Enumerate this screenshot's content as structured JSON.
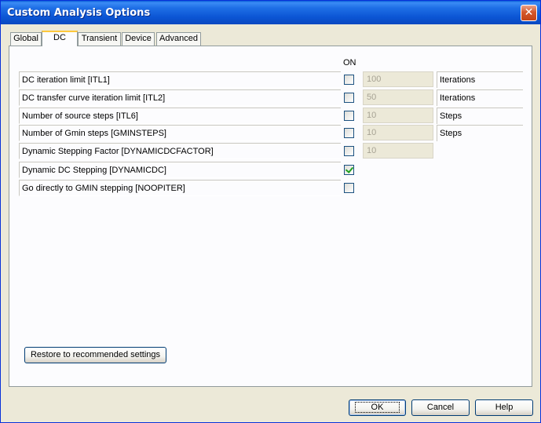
{
  "window": {
    "title": "Custom Analysis Options",
    "close_glyph": "✕"
  },
  "tabs": [
    {
      "label": "Global",
      "active": false
    },
    {
      "label": "DC",
      "active": true
    },
    {
      "label": "Transient",
      "active": false
    },
    {
      "label": "Device",
      "active": false
    },
    {
      "label": "Advanced",
      "active": false
    }
  ],
  "dc": {
    "on_header": "ON",
    "rows": [
      {
        "label": "DC iteration limit [ITL1]",
        "checked": false,
        "value": "100",
        "unit": "Iterations"
      },
      {
        "label": "DC transfer curve iteration limit [ITL2]",
        "checked": false,
        "value": "50",
        "unit": "Iterations"
      },
      {
        "label": "Number of source steps [ITL6]",
        "checked": false,
        "value": "10",
        "unit": "Steps"
      },
      {
        "label": "Number of Gmin steps [GMINSTEPS]",
        "checked": false,
        "value": "10",
        "unit": "Steps"
      },
      {
        "label": "Dynamic Stepping Factor [DYNAMICDCFACTOR]",
        "checked": false,
        "value": "10",
        "unit": ""
      },
      {
        "label": "Dynamic DC Stepping [DYNAMICDC]",
        "checked": true
      },
      {
        "label": "Go directly to GMIN stepping [NOOPITER]",
        "checked": false
      }
    ],
    "restore_label": "Restore to recommended settings"
  },
  "footer": {
    "ok_label": "OK",
    "cancel_label": "Cancel",
    "help_label": "Help"
  },
  "colors": {
    "title_bar": "#0b55d4",
    "active_tab_accent": "#ffc83c",
    "checkmark": "#21a121"
  }
}
